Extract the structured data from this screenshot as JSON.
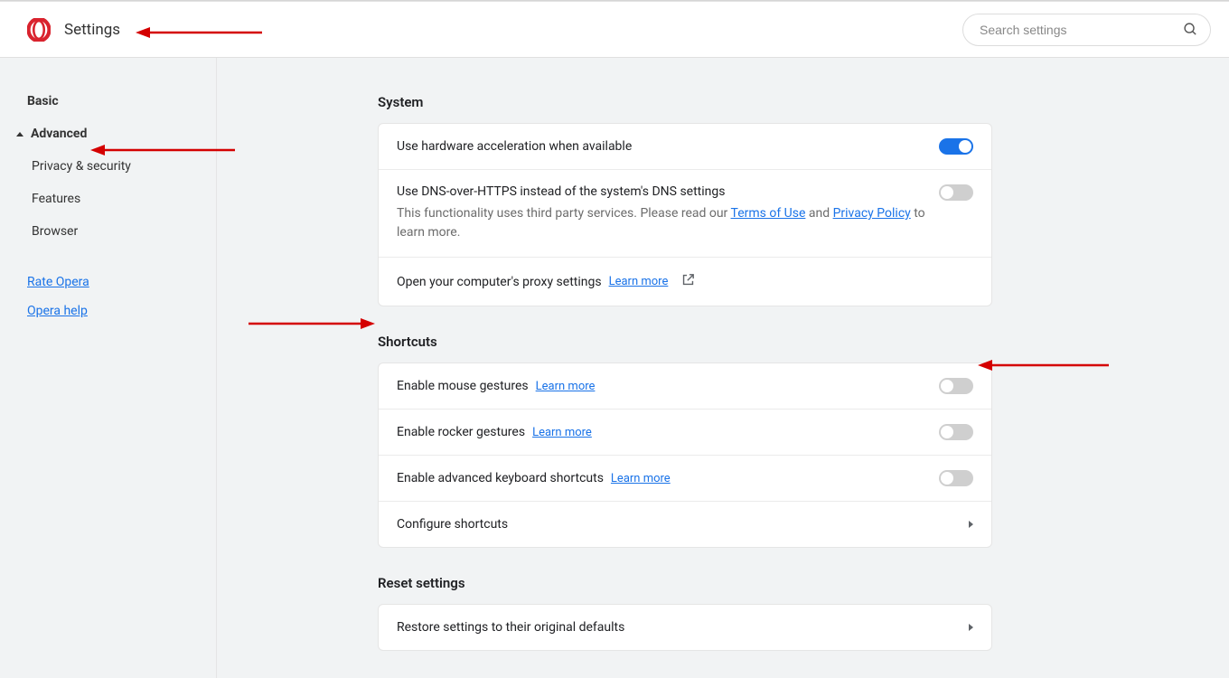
{
  "header": {
    "title": "Settings",
    "search_placeholder": "Search settings"
  },
  "sidebar": {
    "basic": "Basic",
    "advanced": "Advanced",
    "privacy": "Privacy & security",
    "features": "Features",
    "browser": "Browser",
    "rate": "Rate Opera",
    "help": "Opera help"
  },
  "sections": {
    "system": {
      "title": "System",
      "hw_accel": "Use hardware acceleration when available",
      "dns_title": "Use DNS-over-HTTPS instead of the system's DNS settings",
      "dns_desc_a": "This functionality uses third party services. Please read our ",
      "dns_terms": "Terms of Use",
      "dns_and": " and ",
      "dns_privacy": "Privacy Policy",
      "dns_desc_b": " to learn more.",
      "proxy": "Open your computer's proxy settings",
      "learn_more": "Learn more"
    },
    "shortcuts": {
      "title": "Shortcuts",
      "mouse": "Enable mouse gestures",
      "rocker": "Enable rocker gestures",
      "keyboard": "Enable advanced keyboard shortcuts",
      "learn_more": "Learn more",
      "configure": "Configure shortcuts"
    },
    "reset": {
      "title": "Reset settings",
      "restore": "Restore settings to their original defaults"
    }
  }
}
